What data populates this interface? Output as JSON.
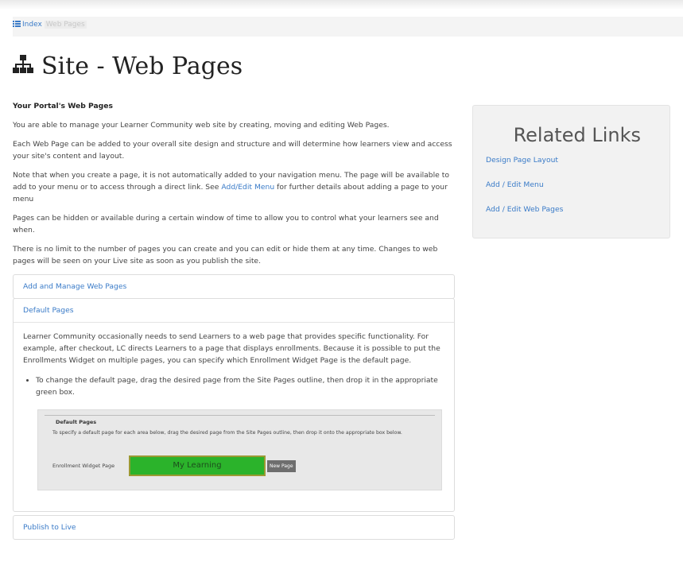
{
  "breadcrumb": {
    "index_label": "Index",
    "current_label": "Web Pages"
  },
  "page": {
    "title": "Site - Web Pages",
    "title_icon": "sitemap-icon"
  },
  "intro": {
    "heading": "Your Portal's Web Pages",
    "p1": "You are able to manage your Learner Community web site by creating, moving and editing Web Pages.",
    "p2": "Each Web Page can be added to your overall site design and structure and will determine how learners view and access your site's content and layout.",
    "p3_before": "Note that when you create a page, it is not automatically added to your navigation menu. The page will be available to add to your menu or to access through a direct link. See ",
    "p3_link": "Add/Edit Menu",
    "p3_after": " for further details about adding a page to your menu",
    "p4": "Pages can be hidden or available during a certain window of time to allow you to control what your learners see and when.",
    "p5": "There is no limit to the number of pages you can create and you can edit or hide them at any time. Changes to web pages will be seen on your Live site as soon as you publish the site."
  },
  "accordion": {
    "item1": "Add and Manage Web Pages",
    "item2": "Default Pages",
    "item2_body": "Learner Community occasionally needs to send Learners to a web page that provides specific functionality. For example, after checkout, LC directs Learners to a page that displays enrollments. Because it is possible to put the Enrollments Widget on multiple pages, you can specify which Enrollment Widget Page is the default page.",
    "item2_bullet": "To change the default page, drag the desired page from the Site Pages outline, then drop it in the appropriate green box.",
    "item3": "Publish to Live"
  },
  "figure": {
    "title": "Default Pages",
    "desc": "To specify a default page for each area below, drag the desired page from the Site Pages outline, then drop it onto the appropriate box below.",
    "label": "Enrollment Widget Page",
    "drop_value": "My Learning",
    "new_page": "New Page",
    "drop_color": "#2bb32b"
  },
  "sidebar": {
    "title": "Related Links",
    "links": [
      "Design Page Layout",
      "Add / Edit Menu",
      "Add / Edit Web Pages"
    ]
  },
  "colors": {
    "link": "#3a7bc8",
    "sidebar_bg": "#f2f2f2"
  }
}
